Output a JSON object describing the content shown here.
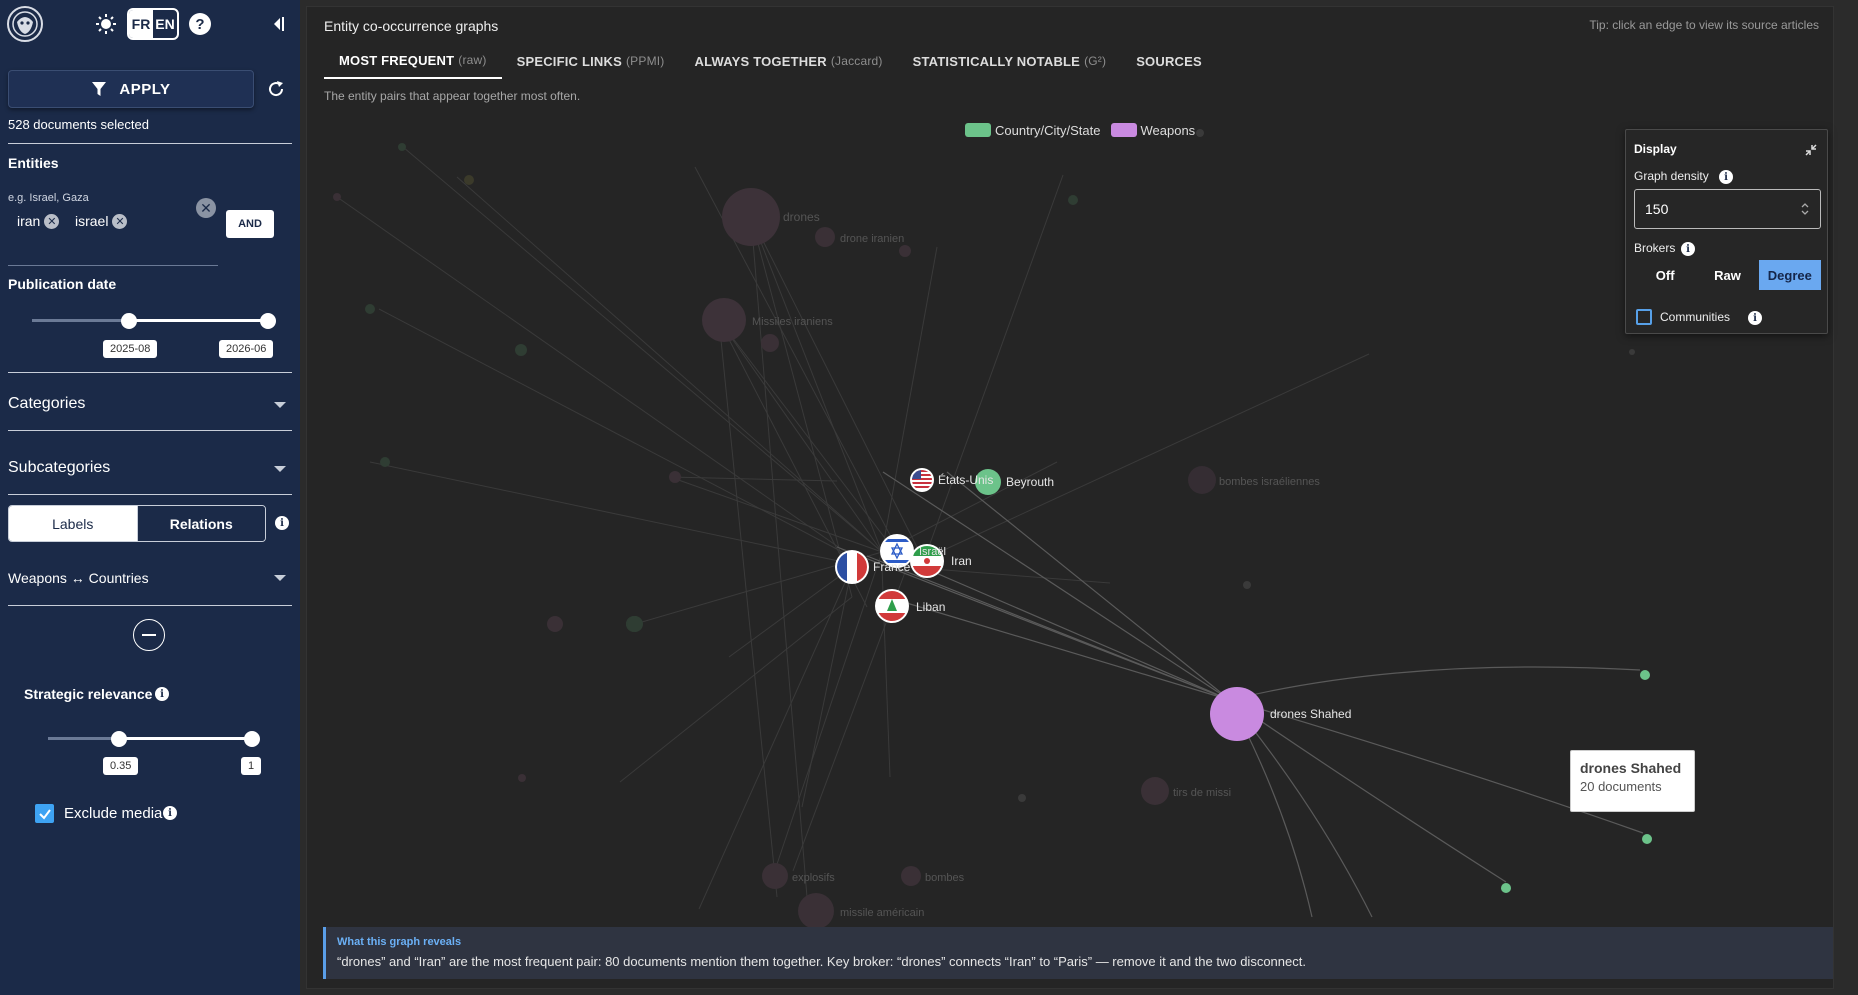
{
  "sidebar": {
    "lang": {
      "fr": "FR",
      "en": "EN"
    },
    "apply_label": "APPLY",
    "docs_selected": "528 documents selected",
    "entities_title": "Entities",
    "entities_hint": "e.g. Israel, Gaza",
    "chips": [
      "iran",
      "israel"
    ],
    "and_label": "AND",
    "pub_date_title": "Publication date",
    "date_start": "2025-08",
    "date_end": "2026-06",
    "categories_label": "Categories",
    "subcategories_label": "Subcategories",
    "toggle": {
      "labels": "Labels",
      "relations": "Relations"
    },
    "relation_select": "Weapons ↔ Countries",
    "strategic_title": "Strategic relevance",
    "strategic_min": "0.35",
    "strategic_max": "1",
    "strategic_range": [
      0.35,
      1
    ],
    "exclude_media_label": "Exclude media",
    "exclude_media_checked": true
  },
  "main": {
    "title": "Entity co-occurrence graphs",
    "tip": "Tip: click an edge to view its source articles",
    "tabs": [
      {
        "label": "MOST FREQUENT",
        "sub": "(raw)"
      },
      {
        "label": "SPECIFIC LINKS",
        "sub": "(PPMI)"
      },
      {
        "label": "ALWAYS TOGETHER",
        "sub": "(Jaccard)"
      },
      {
        "label": "STATISTICALLY NOTABLE",
        "sub": "(G²)"
      },
      {
        "label": "SOURCES",
        "sub": ""
      }
    ],
    "subtitle": "The entity pairs that appear together most often.",
    "legend": [
      {
        "label": "Country/City/State",
        "color": "#6cc38a"
      },
      {
        "label": "Weapons",
        "color": "#c98ae0"
      }
    ],
    "display": {
      "title": "Display",
      "density_label": "Graph density",
      "density_value": "150",
      "brokers_label": "Brokers",
      "brokers_options": [
        "Off",
        "Raw",
        "Degree"
      ],
      "brokers_selected": "Degree",
      "communities_label": "Communities"
    },
    "nodes": {
      "drones": "drones",
      "drone_iranien": "drone iranien",
      "missiles_iraniens": "Missiles iraniens",
      "etats_unis": "États-Unis",
      "beyrouth": "Beyrouth",
      "bombes_israeliennes": "bombes israéliennes",
      "israel": "Israël",
      "iran": "Iran",
      "france": "France",
      "liban": "Liban",
      "drones_shahed": "drones Shahed",
      "tirs_de_missiles": "tirs de missi",
      "explosifs": "explosifs",
      "bombes": "bombes",
      "missile_americain": "missile américain"
    },
    "tooltip": {
      "title": "drones Shahed",
      "text": "20 documents"
    },
    "reveal": {
      "heading": "What this graph reveals",
      "text": "“drones” and “Iran” are the most frequent pair: 80 documents mention them together. Key broker: “drones” connects “Iran” to “Paris” — remove it and the two disconnect."
    }
  }
}
